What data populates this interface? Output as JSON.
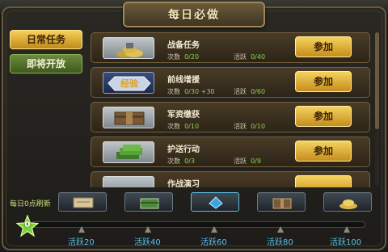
{
  "background": {
    "left_text": "",
    "right_text": ""
  },
  "header": {
    "title": "每日必做"
  },
  "tabs": [
    {
      "label": "日常任务",
      "active": true
    },
    {
      "label": "即将开放",
      "active": false
    }
  ],
  "tasks": [
    {
      "name": "战备任务",
      "thumb_icon": "coin-pile-icon",
      "times_label": "次数",
      "times_value": "0/20",
      "times_extra": "",
      "activity_label": "活跃",
      "activity_value": "0/40",
      "button_label": "参加"
    },
    {
      "name": "前线增援",
      "thumb_icon": "experience-badge-icon",
      "thumb_text": "经验",
      "times_label": "次数",
      "times_value": "0/30",
      "times_extra": "+30",
      "activity_label": "活跃",
      "activity_value": "0/60",
      "button_label": "参加"
    },
    {
      "name": "军资缴获",
      "thumb_icon": "supply-crate-icon",
      "times_label": "次数",
      "times_value": "0/10",
      "times_extra": "",
      "activity_label": "活跃",
      "activity_value": "0/10",
      "button_label": "参加"
    },
    {
      "name": "护送行动",
      "thumb_icon": "cash-stack-icon",
      "times_label": "次数",
      "times_value": "0/3",
      "times_extra": "",
      "activity_label": "活跃",
      "activity_value": "0/9",
      "button_label": "参加"
    },
    {
      "name": "作战演习",
      "thumb_icon": "training-icon",
      "times_label": "",
      "times_value": "",
      "times_extra": "",
      "activity_label": "",
      "activity_value": "",
      "button_label": ""
    }
  ],
  "rewards": {
    "refresh_note": "每日0点刷新",
    "current_activity": "0",
    "progress": 0,
    "milestones": [
      "活跃20",
      "活跃40",
      "活跃60",
      "活跃80",
      "活跃100"
    ]
  },
  "colors": {
    "accent_gold": "#f5d25e",
    "value_green": "#8fd14f",
    "milestone_blue": "#5cc0e8"
  }
}
